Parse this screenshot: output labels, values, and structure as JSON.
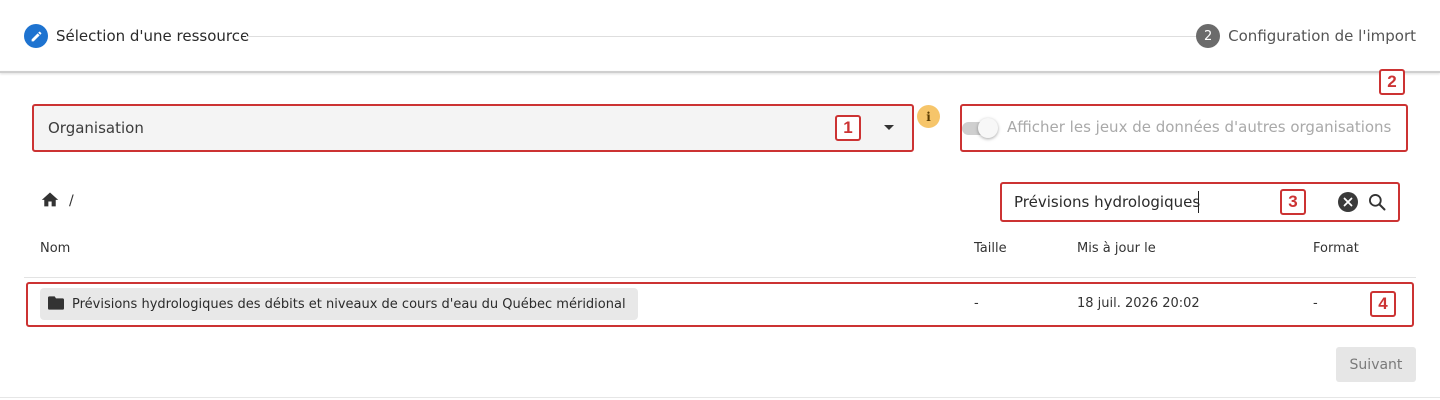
{
  "stepper": {
    "step1": {
      "number": "",
      "label": "Sélection d'une ressource",
      "state": "active",
      "icon": "pencil-icon"
    },
    "step2": {
      "number": "2",
      "label": "Configuration de l'import",
      "state": "inactive"
    }
  },
  "filters": {
    "organisation_label": "Organisation",
    "info_icon": "i",
    "toggle_label": "Afficher les jeux de données d'autres organisations",
    "toggle_on": false
  },
  "breadcrumb": {
    "separator": "/"
  },
  "search": {
    "value": "Prévisions hydrologiques"
  },
  "annotations": {
    "a1": "1",
    "a2": "2",
    "a3": "3",
    "a4": "4"
  },
  "table": {
    "headers": {
      "name": "Nom",
      "size": "Taille",
      "updated": "Mis à jour le",
      "format": "Format"
    },
    "rows": [
      {
        "name": "Prévisions hydrologiques des débits et niveaux de cours d'eau du Québec méridional",
        "size": "-",
        "updated": "18 juil. 2026 20:02",
        "format": "-"
      }
    ]
  },
  "footer": {
    "next_label": "Suivant"
  },
  "colors": {
    "accent": "#1e73d0",
    "annotation": "#cc3333",
    "info": "#f6c56a"
  }
}
